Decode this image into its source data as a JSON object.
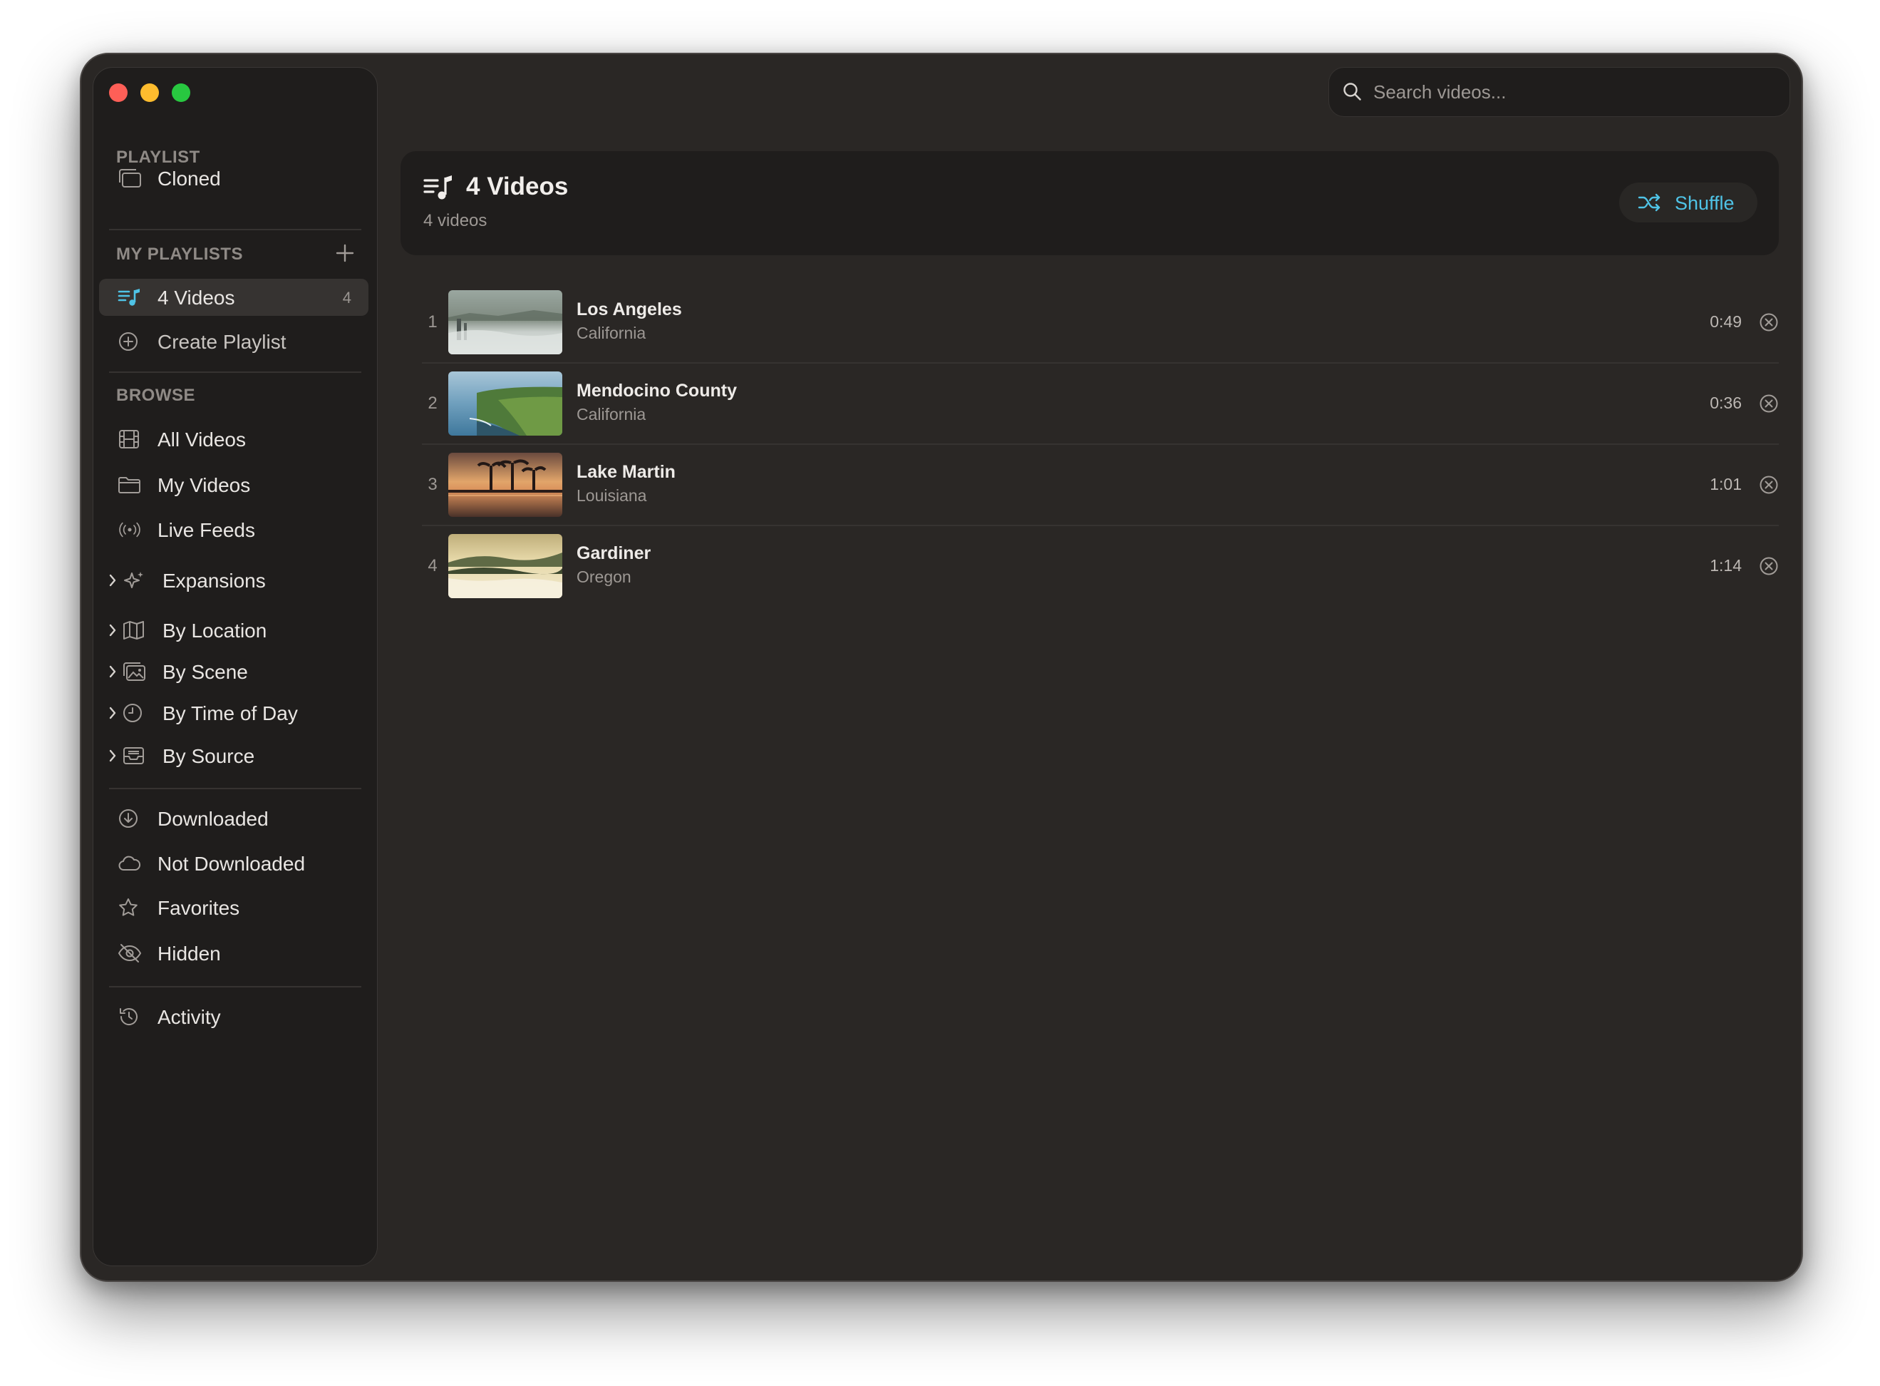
{
  "sidebar": {
    "playlist_section": "PLAYLIST",
    "cloned_label": "Cloned",
    "my_playlists_section": "MY PLAYLISTS",
    "playlists": [
      {
        "label": "4 Videos",
        "count": "4",
        "active": true
      }
    ],
    "create_playlist_label": "Create Playlist",
    "browse_section": "BROWSE",
    "browse_items": [
      "All Videos",
      "My Videos",
      "Live Feeds"
    ],
    "expand_items": [
      "Expansions",
      "By Location",
      "By Scene",
      "By Time of Day",
      "By Source"
    ],
    "filter_items": [
      "Downloaded",
      "Not Downloaded",
      "Favorites",
      "Hidden"
    ],
    "activity_label": "Activity"
  },
  "search": {
    "placeholder": "Search videos..."
  },
  "header": {
    "title": "4 Videos",
    "subtitle": "4 videos",
    "shuffle_label": "Shuffle"
  },
  "videos": [
    {
      "index": "1",
      "title": "Los Angeles",
      "location": "California",
      "duration": "0:49"
    },
    {
      "index": "2",
      "title": "Mendocino County",
      "location": "California",
      "duration": "0:36"
    },
    {
      "index": "3",
      "title": "Lake Martin",
      "location": "Louisiana",
      "duration": "1:01"
    },
    {
      "index": "4",
      "title": "Gardiner",
      "location": "Oregon",
      "duration": "1:14"
    }
  ],
  "colors": {
    "accent": "#4fc3e6",
    "window_bg": "#2a2725",
    "sidebar_bg": "#1f1d1c"
  }
}
